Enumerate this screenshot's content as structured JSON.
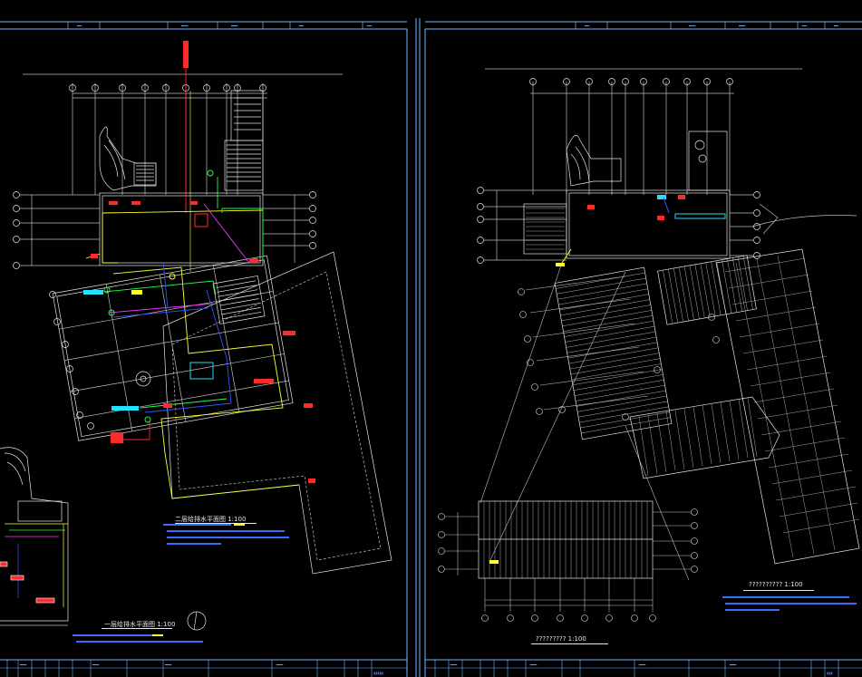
{
  "sheets": [
    {
      "id": "left",
      "titles": [
        {
          "text": "二层给排水平面图 1:100"
        },
        {
          "text": "一层给排水平面图 1:100"
        }
      ]
    },
    {
      "id": "right",
      "titles": [
        {
          "text": "?????????? 1:100"
        },
        {
          "text": "????????? 1:100"
        }
      ]
    }
  ],
  "colors": {
    "background": "#000000",
    "frame": "#6fb7ff",
    "wall": "#e6e6e6",
    "dim": "#bdbdbd",
    "red": "#ff2a2a",
    "yellow": "#ffff33",
    "green": "#22ff44",
    "magenta": "#ff33ff",
    "blue": "#3355ff",
    "cyan": "#22e0ff",
    "notes": "#3a6bff"
  }
}
